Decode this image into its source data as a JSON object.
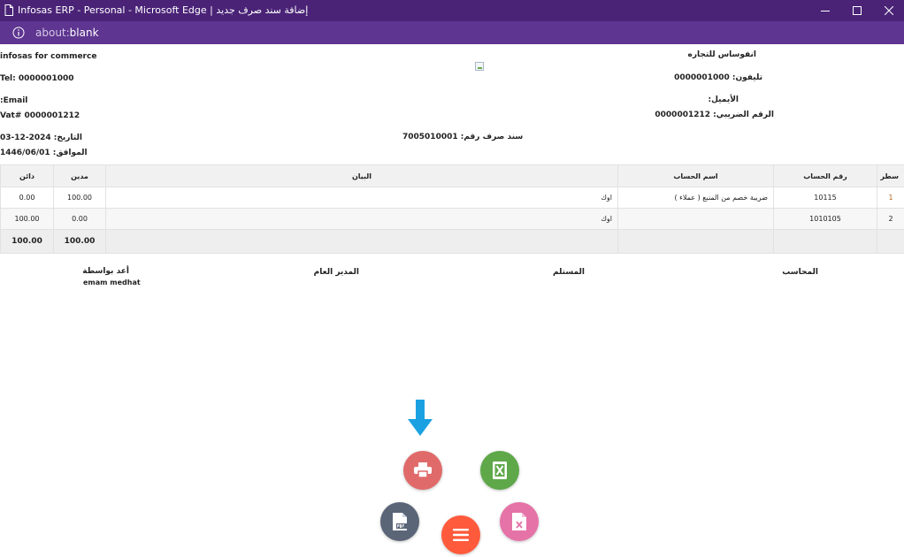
{
  "window": {
    "title": "Infosas ERP - Personal - Microsoft Edge | إضافة سند صرف جديد",
    "url_scheme": "about:",
    "url_host": "blank"
  },
  "company": {
    "name_en": "infosas for commerce",
    "tel_en": "Tel: 0000001000",
    "email_en": ":Email",
    "vat_en": "Vat# 0000001212",
    "name_ar": "انفوساس للتجاره",
    "tel_ar": "تليفون: 0000001000",
    "email_ar": "الأيميل:",
    "vat_ar": "الرقم الضريبي: 0000001212"
  },
  "voucher": {
    "date": "التاريخ: 2024-12-03",
    "hijri": "الموافق: 1446/06/01",
    "number": "سند صرف رقم: 7005010001"
  },
  "table": {
    "headers": {
      "line": "سطر",
      "account_no": "رقم الحساب",
      "account_name": "اسم الحساب",
      "statement": "البيان",
      "debit": "مدين",
      "credit": "دائن"
    },
    "rows": [
      {
        "line": "1",
        "account_no": "10115",
        "account_name": "ضريبة خصم من المنبع ( عملاء )",
        "statement": "اوك",
        "debit": "100.00",
        "credit": "0.00"
      },
      {
        "line": "2",
        "account_no": "1010105",
        "account_name": "",
        "statement": "اوك",
        "debit": "0.00",
        "credit": "100.00"
      }
    ],
    "totals": {
      "debit": "100.00",
      "credit": "100.00"
    }
  },
  "signatures": {
    "accountant": "المحاسب",
    "receiver": "المستلم",
    "general_manager": "المدير العام",
    "prepared_by": "أعد بواسطة",
    "prepared_by_name": "emam medhat"
  },
  "colors": {
    "titlebar": "#4a2377",
    "addressbar": "#5e3590",
    "print": "#e06a6a",
    "excel": "#5fa84a",
    "pdf": "#5b6578",
    "x_file": "#e673a8",
    "menu": "#ff5a3c",
    "arrow": "#1ba1e2"
  },
  "icons": [
    "document-icon",
    "minimize-icon",
    "maximize-icon",
    "close-icon",
    "info-icon",
    "down-arrow-icon",
    "printer-icon",
    "excel-icon",
    "pdf-icon",
    "x-file-icon",
    "menu-icon"
  ]
}
